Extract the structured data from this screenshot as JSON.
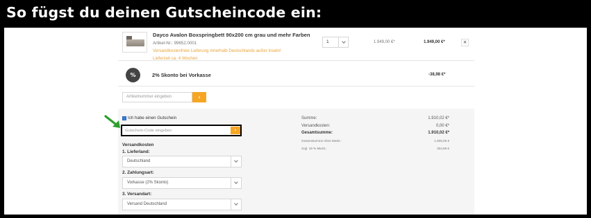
{
  "banner": {
    "title": "So fügst du deinen Gutscheincode ein:"
  },
  "cart": {
    "product": {
      "name": "Dayco Avalon Boxspringbett 90x200 cm grau und mehr Farben",
      "article_number": "Artikel-Nr.: 99652.0001",
      "shipping_note": "Versandkostenfreie Lieferung innerhalb Deutschlands außer Inseln!",
      "delivery_time": "Lieferzeit ca. 4 Wochen",
      "quantity": "1",
      "unit_price": "1.949,00 €*",
      "total_price": "1.949,00 €*",
      "remove_icon": "close-icon"
    },
    "discount": {
      "badge": "%",
      "label": "2% Skonto bei Vorkasse",
      "price": "-38,98 €*"
    },
    "article_input": {
      "placeholder": "Artikelnummer eingeben",
      "button_icon": "chevron-right-icon"
    }
  },
  "voucher": {
    "checkbox_label": "Ich habe einen Gutschein",
    "checked": true,
    "input_placeholder": "Gutschein-Code eingeben",
    "button_icon": "chevron-right-icon",
    "arrow_color": "#2e9e2e"
  },
  "shipping": {
    "heading": "Versandkosten",
    "country_label": "1. Lieferland:",
    "country_value": "Deutschland",
    "payment_label": "2. Zahlungsart:",
    "payment_value": "Vorkasse (2% Skonto)",
    "method_label": "3. Versandart:",
    "method_value": "Versand Deutschland"
  },
  "summary": {
    "rows": [
      {
        "label": "Summe:",
        "value": "1.910,02 €*"
      },
      {
        "label": "Versandkosten:",
        "value": "0,00 €*"
      },
      {
        "label": "Gesamtsumme:",
        "value": "1.910,02 €*"
      },
      {
        "label": "Gesamtsumme ohne MwSt.:",
        "value": "1.605,06 €"
      },
      {
        "label": "zzgl. 19 % MwSt.:",
        "value": "304,96 €"
      }
    ]
  },
  "colors": {
    "accent": "#f6a623",
    "banner_bg": "#000000",
    "highlight_border": "#000000"
  }
}
